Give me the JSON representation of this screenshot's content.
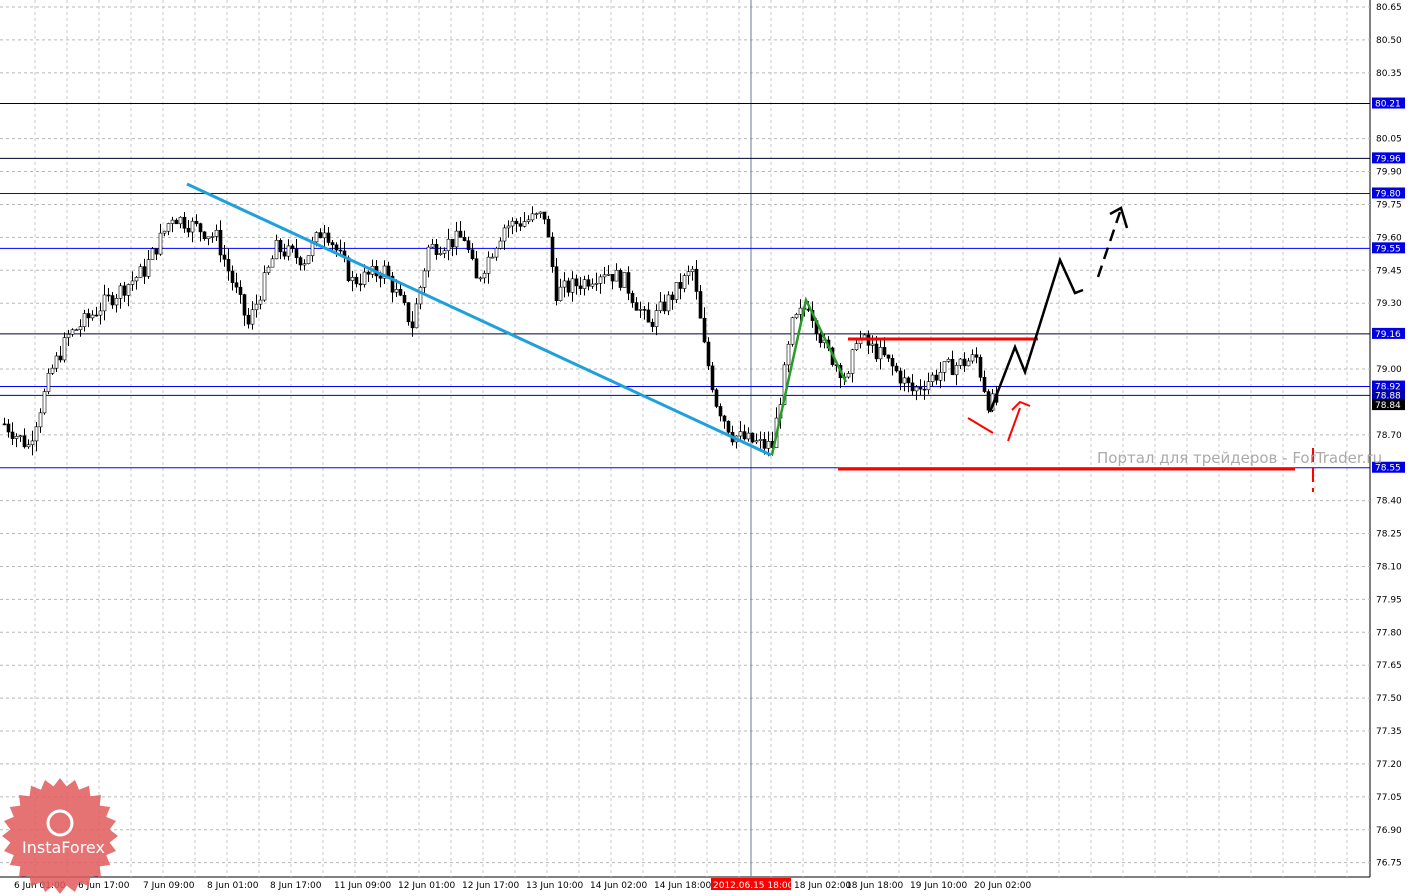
{
  "chart_data": {
    "type": "candlestick",
    "symbol_timeframe": "H1",
    "ylim": [
      76.75,
      80.65
    ],
    "y_ticks": [
      "80.65",
      "80.50",
      "80.35",
      "80.05",
      "79.90",
      "79.75",
      "79.60",
      "79.45",
      "79.30",
      "79.00",
      "78.70",
      "78.40",
      "78.25",
      "78.10",
      "77.95",
      "77.80",
      "77.65",
      "77.50",
      "77.35",
      "77.20",
      "77.05",
      "76.90",
      "76.75"
    ],
    "x_ticks": [
      "6 Jun 01:00",
      "6 Jun 17:00",
      "7 Jun 09:00",
      "8 Jun 01:00",
      "8 Jun 17:00",
      "11 Jun 09:00",
      "12 Jun 01:00",
      "12 Jun 17:00",
      "13 Jun 10:00",
      "14 Jun 02:00",
      "14 Jun 18:00",
      "2012.06.15 18:00",
      "18 Jun 02:00",
      "18 Jun 18:00",
      "19 Jun 10:00",
      "20 Jun 02:00"
    ],
    "highlighted_time": "2012.06.15 18:00",
    "price_path_anchors": [
      [
        0,
        78.75
      ],
      [
        6,
        78.65
      ],
      [
        12,
        79.0
      ],
      [
        16,
        79.15
      ],
      [
        25,
        79.3
      ],
      [
        35,
        79.45
      ],
      [
        42,
        79.7
      ],
      [
        53,
        79.6
      ],
      [
        57,
        79.4
      ],
      [
        61,
        79.2
      ],
      [
        68,
        79.55
      ],
      [
        75,
        79.5
      ],
      [
        80,
        79.65
      ],
      [
        87,
        79.4
      ],
      [
        95,
        79.45
      ],
      [
        102,
        79.2
      ],
      [
        106,
        79.55
      ],
      [
        115,
        79.6
      ],
      [
        118,
        79.4
      ],
      [
        125,
        79.65
      ],
      [
        135,
        79.7
      ],
      [
        138,
        79.35
      ],
      [
        145,
        79.4
      ],
      [
        150,
        79.45
      ],
      [
        155,
        79.4
      ],
      [
        161,
        79.2
      ],
      [
        172,
        79.45
      ],
      [
        175,
        79.1
      ],
      [
        178,
        78.85
      ],
      [
        182,
        78.7
      ],
      [
        190,
        78.65
      ],
      [
        192,
        78.65
      ],
      [
        197,
        79.2
      ],
      [
        201,
        79.3
      ],
      [
        205,
        79.1
      ],
      [
        211,
        78.95
      ],
      [
        213,
        79.15
      ],
      [
        220,
        79.05
      ],
      [
        227,
        78.9
      ],
      [
        235,
        79.0
      ],
      [
        243,
        79.05
      ],
      [
        246,
        78.85
      ],
      [
        248,
        78.85
      ]
    ],
    "level_lines": [
      {
        "price": 80.21,
        "label": "80.21",
        "color": "#000033"
      },
      {
        "price": 79.96,
        "label": "79.96",
        "color": "#000033"
      },
      {
        "price": 79.8,
        "label": "79.80",
        "color": "#0000ff"
      },
      {
        "price": 79.55,
        "label": "79.55",
        "color": "#0000ff"
      },
      {
        "price": 79.16,
        "label": "79.16",
        "color": "#000033"
      },
      {
        "price": 78.92,
        "label": "78.92",
        "color": "#0000ff"
      },
      {
        "price": 78.88,
        "label": "78.88",
        "color": "#0000aa"
      },
      {
        "price": 78.55,
        "label": "78.55",
        "color": "#0000ff"
      }
    ],
    "current_price": "78.84"
  },
  "watermark": "Портал для трейдеров - ForTrader.ru",
  "logo": "InstaForex",
  "colors": {
    "trendline": "#1ea0dc",
    "impulse": "#2a9a2a",
    "support_resistance": "#ff0000",
    "forecast": "#000000",
    "label_bg": "#0000ff"
  }
}
